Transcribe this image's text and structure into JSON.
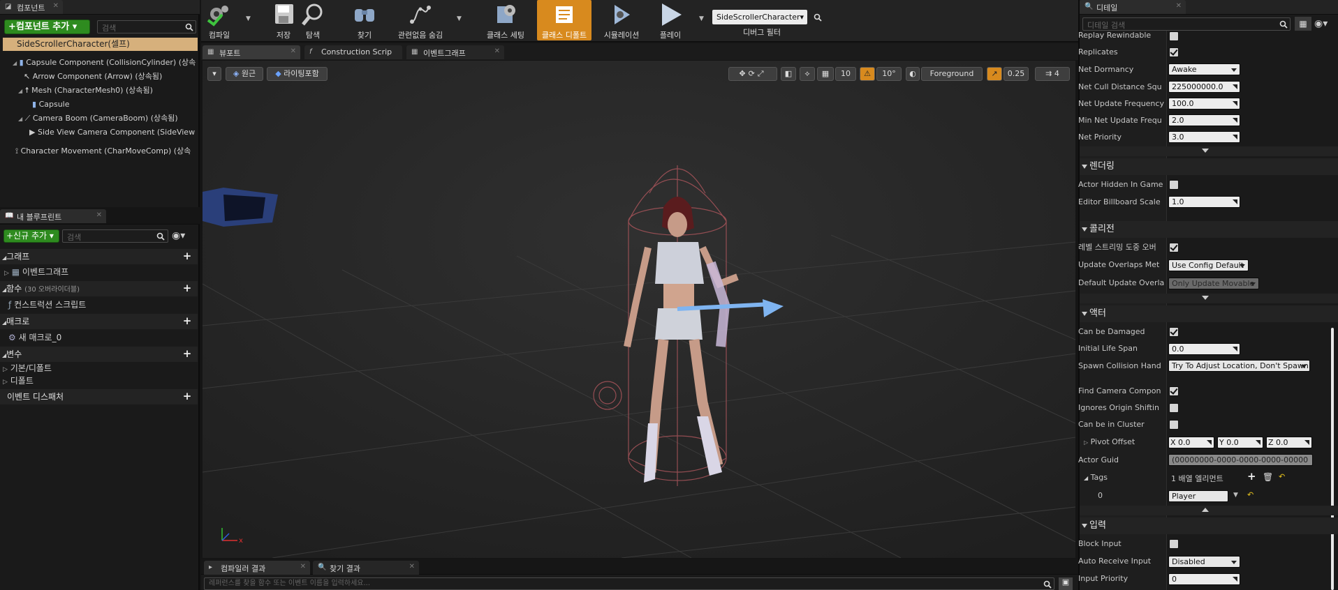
{
  "components": {
    "tab_label": "컴포넌트",
    "add_button": "+컴포넌트 추가 ▾",
    "search_placeholder": "검색",
    "root": "SideScrollerCharacter(셀프)",
    "items": [
      {
        "label": "Capsule Component (CollisionCylinder) (상속",
        "indent": 0
      },
      {
        "label": "Arrow Component (Arrow) (상속됨)",
        "indent": 1
      },
      {
        "label": "Mesh (CharacterMesh0) (상속됨)",
        "indent": 1
      },
      {
        "label": "Capsule",
        "indent": 2
      },
      {
        "label": "Camera Boom (CameraBoom) (상속됨)",
        "indent": 1
      },
      {
        "label": "Side View Camera Component (SideView",
        "indent": 2
      },
      {
        "label": "Character Movement (CharMoveComp) (상속",
        "indent": 0
      }
    ]
  },
  "blueprint": {
    "tab_label": "내 블루프린트",
    "add_new_button": "+신규 추가 ▾",
    "search_placeholder": "검색",
    "sections": {
      "graph": "그래프",
      "event_graph": "이벤트그래프",
      "functions": "함수",
      "functions_note": "(30 오버라이더블)",
      "construction_script": "컨스트럭션 스크립트",
      "macros": "매크로",
      "new_macro": "새 매크로_0",
      "variables": "변수",
      "defaults_category": "기본/디폴트",
      "defaults": "디폴트",
      "event_dispatchers": "이벤트 디스패처"
    }
  },
  "toolbar": {
    "compile": "컴파일",
    "save": "저장",
    "browse": "탐색",
    "find": "찾기",
    "hide_unrelated": "관련없음 숨김",
    "class_settings": "클래스 세팅",
    "class_defaults": "클래스 디폴트",
    "simulation": "시뮬레이션",
    "play": "플레이",
    "debug_object": "SideScrollerCharacter▾",
    "debug_filter": "디버그 필터"
  },
  "editor_tabs": [
    "뷰포트",
    "Construction Scrip",
    "이벤트그래프"
  ],
  "viewport": {
    "perspective": "원근",
    "lit": "라이팅포함",
    "grid_snap": "10",
    "rot_snap": "10°",
    "layer": "Foreground",
    "scale_snap": "0.25",
    "cam_speed": "4",
    "axis_x": "x"
  },
  "bottom": {
    "tabs": [
      "컴파일러 결과",
      "찾기 결과"
    ],
    "search_placeholder": "레퍼런스를 찾을 함수 또는 이벤트 이름을 입력하세요..."
  },
  "details": {
    "tab_label": "디테일",
    "search_placeholder": "디테일 검색",
    "replication": [
      {
        "label": "Replay Rewindable",
        "type": "check",
        "value": false
      },
      {
        "label": "Replicates",
        "type": "check",
        "value": true
      },
      {
        "label": "Net Dormancy",
        "type": "combo",
        "value": "Awake"
      },
      {
        "label": "Net Cull Distance Squ",
        "type": "num",
        "value": "225000000.0"
      },
      {
        "label": "Net Update Frequency",
        "type": "num",
        "value": "100.0"
      },
      {
        "label": "Min Net Update Frequ",
        "type": "num",
        "value": "2.0"
      },
      {
        "label": "Net Priority",
        "type": "num",
        "value": "3.0"
      }
    ],
    "rendering": {
      "title": "렌더링",
      "rows": [
        {
          "label": "Actor Hidden In Game",
          "type": "check",
          "value": false
        },
        {
          "label": "Editor Billboard Scale",
          "type": "num",
          "value": "1.0"
        }
      ]
    },
    "collision": {
      "title": "콜리전",
      "rows": [
        {
          "label": "레벨 스트리밍 도중 오버",
          "type": "check",
          "value": true
        },
        {
          "label": "Update Overlaps Met",
          "type": "combo",
          "value": "Use Config Default"
        },
        {
          "label": "Default Update Overla",
          "type": "combo",
          "value": "Only Update Movable",
          "disabled": true
        }
      ]
    },
    "actor": {
      "title": "액터",
      "rows": [
        {
          "label": "Can be Damaged",
          "type": "check",
          "value": true
        },
        {
          "label": "Initial Life Span",
          "type": "num",
          "value": "0.0"
        },
        {
          "label": "Spawn Collision Hand",
          "type": "combo",
          "value": "Try To Adjust Location, Don't Spawn"
        },
        {
          "label": "Find Camera Compon",
          "type": "check",
          "value": true
        },
        {
          "label": "Ignores Origin Shiftin",
          "type": "check",
          "value": false
        },
        {
          "label": "Can be in Cluster",
          "type": "check",
          "value": false
        }
      ],
      "pivot_label": "Pivot Offset",
      "pivot": {
        "x": "0.0",
        "y": "0.0",
        "z": "0.0",
        "x_label": "X",
        "y_label": "Y",
        "z_label": "Z"
      },
      "guid_label": "Actor Guid",
      "guid": "(00000000-0000-0000-0000-00000",
      "tags_label": "Tags",
      "tags_count": "1 배열 엘리먼트",
      "tag_index": "0",
      "tag_value": "Player"
    },
    "input": {
      "title": "입력",
      "rows": [
        {
          "label": "Block Input",
          "type": "check",
          "value": false
        },
        {
          "label": "Auto Receive Input",
          "type": "combo",
          "value": "Disabled"
        },
        {
          "label": "Input Priority",
          "type": "num",
          "value": "0"
        }
      ]
    }
  },
  "colors": {
    "accent_orange": "#d88a1e",
    "green_button": "#2e8b1f",
    "selected_row": "#d6b07c"
  }
}
